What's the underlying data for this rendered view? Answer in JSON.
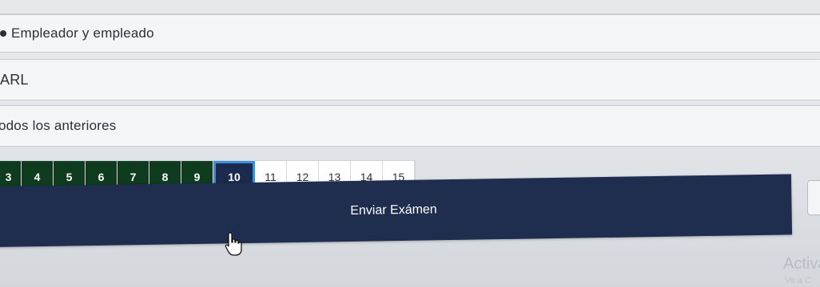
{
  "options": [
    {
      "label": "Empleador y empleado",
      "selected": true
    },
    {
      "label": "ARL",
      "selected": false
    },
    {
      "label": "odos los anteriores",
      "selected": false
    }
  ],
  "pagination": {
    "pages": [
      "3",
      "4",
      "5",
      "6",
      "7",
      "8",
      "9",
      "10",
      "11",
      "12",
      "13",
      "14",
      "15"
    ],
    "current": "10",
    "answered_color": "#0f3b1e",
    "current_color": "#1b2a4e"
  },
  "submit_button": {
    "label": "Enviar Exámen",
    "color": "#1f2d4f"
  },
  "cursor_icon": "hand-pointer-icon",
  "watermark": {
    "title": "Activa",
    "subtitle": "Ve a C"
  }
}
